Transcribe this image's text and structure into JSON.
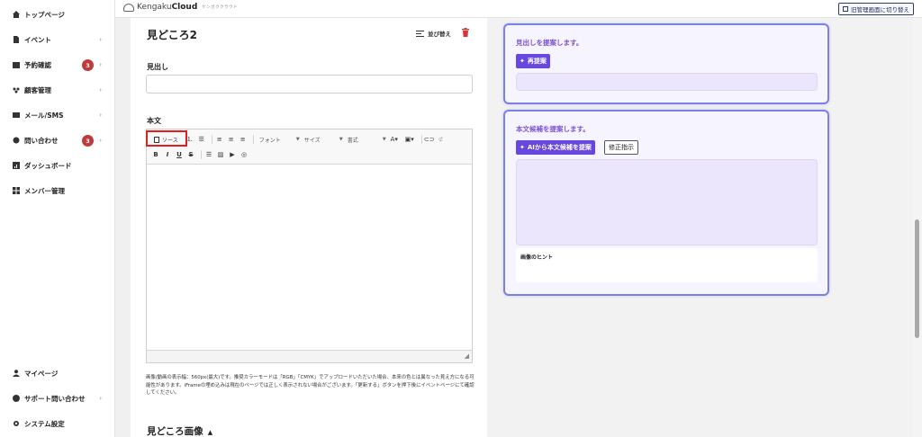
{
  "topbar": {
    "logo_main": "Kengaku",
    "logo_bold": "Cloud",
    "logo_sub": "ケンガククラウド",
    "switch_label": "旧管理画面に切り替え"
  },
  "sidebar": {
    "items": [
      {
        "label": "トップページ",
        "icon": "home-icon"
      },
      {
        "label": "イベント",
        "icon": "document-icon"
      },
      {
        "label": "予約確認",
        "icon": "calendar-icon",
        "badge": "3"
      },
      {
        "label": "顧客管理",
        "icon": "users-icon"
      },
      {
        "label": "メール/SMS",
        "icon": "mail-icon"
      },
      {
        "label": "問い合わせ",
        "icon": "chat-icon",
        "badge": "3"
      },
      {
        "label": "ダッシュボード",
        "icon": "chart-icon"
      },
      {
        "label": "メンバー管理",
        "icon": "grid-icon"
      }
    ],
    "bottom_items": [
      {
        "label": "マイページ",
        "icon": "person-icon"
      },
      {
        "label": "サポート問い合わせ",
        "icon": "help-icon"
      },
      {
        "label": "システム設定",
        "icon": "gear-icon"
      }
    ]
  },
  "editor": {
    "section_title": "見どころ2",
    "sort_label": "並び替え",
    "heading_label": "見出し",
    "heading_value": "",
    "body_label": "本文",
    "toolbar": {
      "source_label": "ソース",
      "font_label": "フォント",
      "size_label": "サイズ",
      "format_label": "書式",
      "bold": "B",
      "italic": "I",
      "underline": "U",
      "strike": "S"
    },
    "help_text": "画像/動画の表示幅：560px(最大)です。推奨カラーモードは「RGB」「CMYK」でアップロードいただいた場合、本来の色とは異なった見え方になる可能性があります。iFrameの埋め込みは現在のページでは正しく表示されない場合がございます。「更新する」ボタンを押下後にイベントページにて確認してください。",
    "gallery_title": "見どころ画像",
    "gallery_caret": "▲"
  },
  "ai_panel": {
    "heading_card": {
      "title": "見出しを提案します。",
      "button_label": "再提案",
      "field_value": ""
    },
    "body_card": {
      "title": "本文候補を提案します。",
      "generate_label": "AIから本文候補を提案",
      "fix_label": "修正指示",
      "field_value": "",
      "hint_label": "画像のヒント"
    }
  },
  "colors": {
    "badge": "#c0393b",
    "accent_purple": "#6748de",
    "card_border": "#7b7fe8",
    "highlight_red": "#e02020"
  }
}
